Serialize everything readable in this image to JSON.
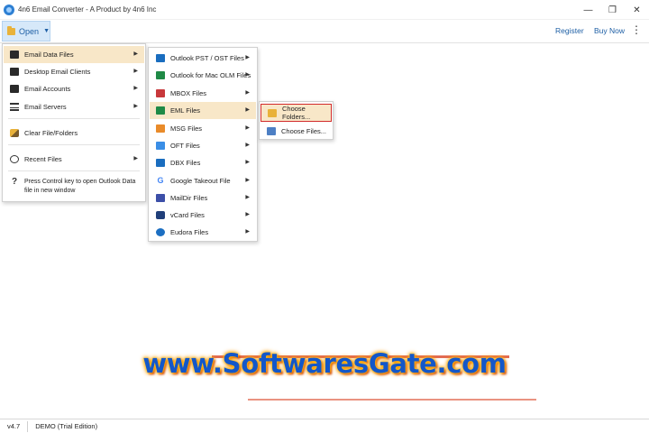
{
  "window": {
    "title": "4n6 Email Converter - A Product by 4n6 Inc",
    "minimize": "—",
    "maximize": "❐",
    "close": "✕"
  },
  "toolbar": {
    "open_label": "Open",
    "open_caret": "▼",
    "register_label": "Register",
    "buy_label": "Buy Now",
    "more": "⋮"
  },
  "open_menu": {
    "items": [
      {
        "label": "Email Data Files",
        "icon": "email-files-icon"
      },
      {
        "label": "Desktop Email Clients",
        "icon": "desktop-icon"
      },
      {
        "label": "Email Accounts",
        "icon": "email-accounts-icon"
      },
      {
        "label": "Email Servers",
        "icon": "server-icon"
      },
      {
        "label": "Clear File/Folders",
        "icon": "brush-icon"
      },
      {
        "label": "Recent Files",
        "icon": "clock-icon"
      }
    ],
    "hint_line1": "Press Control key to open Outlook Data",
    "hint_line2": "file in new window",
    "hint_icon": "?"
  },
  "file_types_menu": {
    "items": [
      {
        "label": "Outlook PST / OST Files",
        "icon": "outlook-icon"
      },
      {
        "label": "Outlook for Mac OLM Files",
        "icon": "outlook-mac-icon"
      },
      {
        "label": "MBOX Files",
        "icon": "mbox-icon"
      },
      {
        "label": "EML Files",
        "icon": "eml-icon"
      },
      {
        "label": "MSG Files",
        "icon": "msg-icon"
      },
      {
        "label": "OFT Files",
        "icon": "oft-icon"
      },
      {
        "label": "DBX Files",
        "icon": "dbx-icon"
      },
      {
        "label": "Google Takeout File",
        "icon": "google-icon",
        "glyph": "G"
      },
      {
        "label": "MailDir Files",
        "icon": "maildir-icon"
      },
      {
        "label": "vCard Files",
        "icon": "vcard-icon"
      },
      {
        "label": "Eudora Files",
        "icon": "eudora-icon"
      }
    ]
  },
  "eml_menu": {
    "choose_folders": "Choose Folders...",
    "choose_files": "Choose Files..."
  },
  "arrow_glyph": "▶",
  "watermark": "www.SoftwaresGate.com",
  "status": {
    "version": "v4.7",
    "edition": "DEMO (Trial Edition)"
  }
}
